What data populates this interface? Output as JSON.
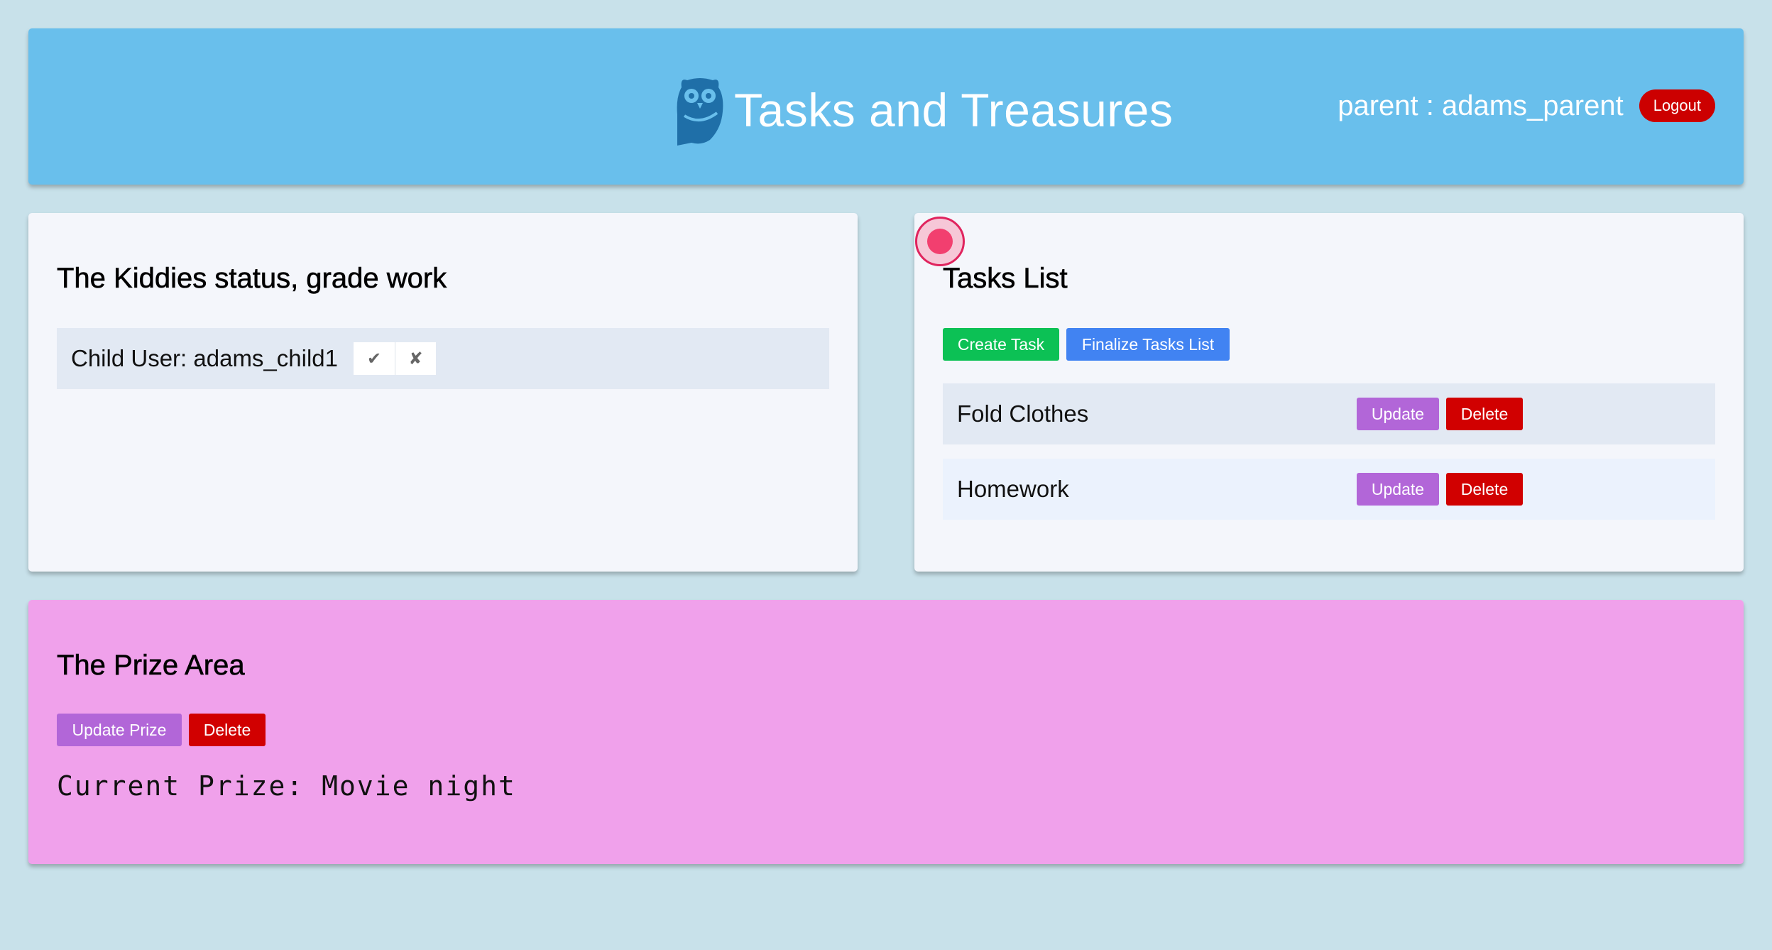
{
  "header": {
    "app_title": "Tasks and Treasures",
    "logo_icon": "owl-icon",
    "user_label": "parent : adams_parent",
    "logout_label": "Logout"
  },
  "colors": {
    "background": "#c8e1ea",
    "header": "#69bfec",
    "prize_area": "#f0a1eb",
    "green": "#0cc155",
    "blue": "#4183f2",
    "purple": "#b266d8",
    "red": "#d10000"
  },
  "kiddies": {
    "title": "The Kiddies status, grade work",
    "child_label": "Child User: adams_child1",
    "approve_icon": "✔",
    "reject_icon": "✘"
  },
  "tasks": {
    "title": "Tasks List",
    "create_label": "Create Task",
    "finalize_label": "Finalize Tasks List",
    "items": [
      {
        "name": "Fold Clothes",
        "update_label": "Update",
        "delete_label": "Delete"
      },
      {
        "name": "Homework",
        "update_label": "Update",
        "delete_label": "Delete"
      }
    ]
  },
  "prize": {
    "title": "The Prize Area",
    "update_label": "Update Prize",
    "delete_label": "Delete",
    "current_prize": "Current Prize: Movie night"
  }
}
